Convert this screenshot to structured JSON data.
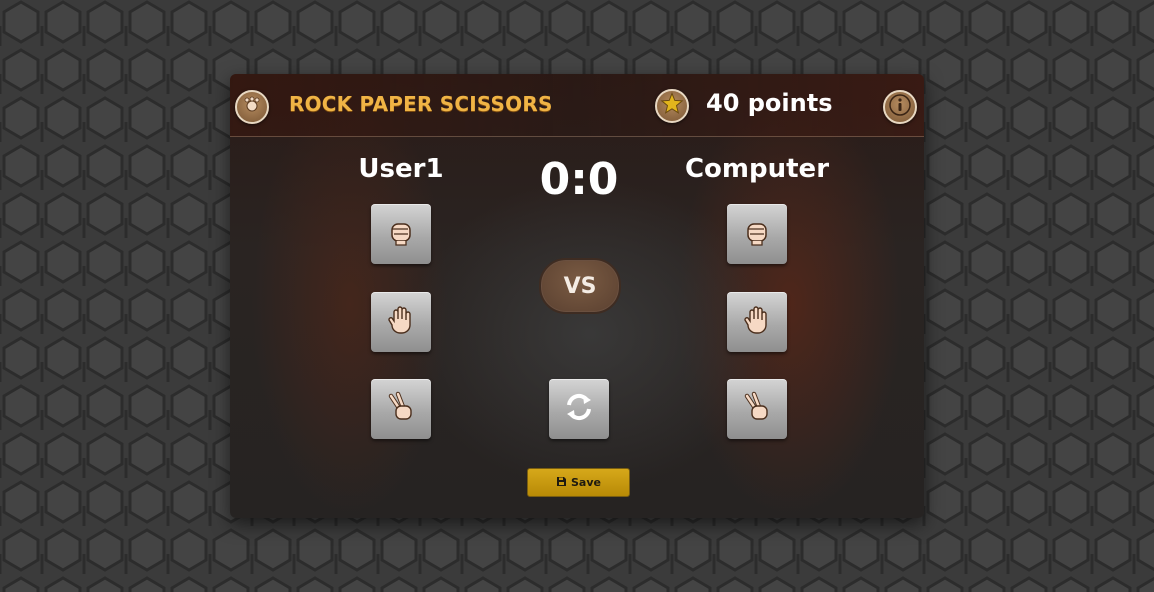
{
  "header": {
    "title": "ROCK PAPER SCISSORS",
    "points_label": "40 points"
  },
  "players": {
    "user": "User1",
    "computer": "Computer"
  },
  "score": "0:0",
  "vs_label": "VS",
  "save_label": "Save",
  "choices": [
    "rock",
    "paper",
    "scissors"
  ],
  "icons": {
    "logo": "hand-logo-icon",
    "star": "star-icon",
    "info": "info-icon",
    "refresh": "refresh-icon",
    "save": "floppy-disk-icon"
  },
  "colors": {
    "title": "#f0b445",
    "save_button": "#c99a10",
    "vs_badge": "#6a4d38",
    "star": "#e2b51c"
  }
}
